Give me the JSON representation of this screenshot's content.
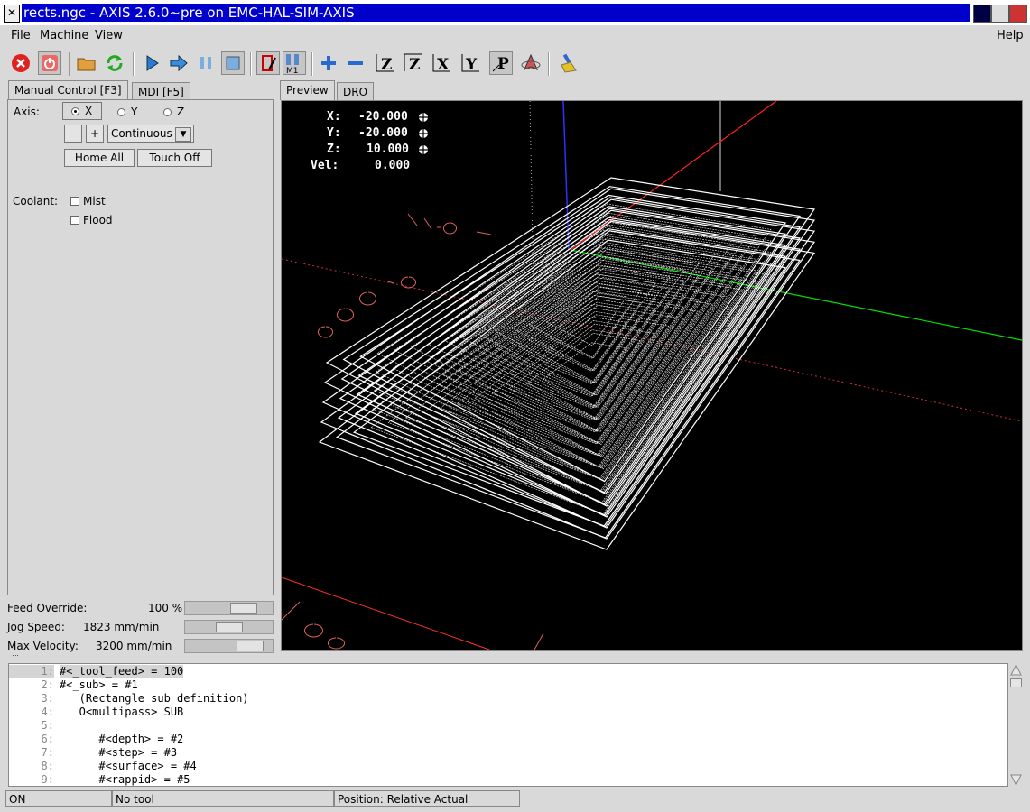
{
  "window": {
    "title": "rects.ngc - AXIS 2.6.0~pre on EMC-HAL-SIM-AXIS"
  },
  "menu": {
    "file": "File",
    "machine": "Machine",
    "view": "View",
    "help": "Help"
  },
  "toolbar": {
    "icons": [
      "estop-icon",
      "power-icon",
      "open-file-icon",
      "reload-icon",
      "run-icon",
      "step-icon",
      "pause-icon",
      "stop-icon",
      "block-delete-icon",
      "optional-stop-icon",
      "zoom-in-icon",
      "zoom-out-icon",
      "view-z-icon",
      "view-z2-icon",
      "view-x-icon",
      "view-y-icon",
      "view-p-icon",
      "rotate-view-icon",
      "clear-plot-icon"
    ],
    "labels": {
      "z": "Z",
      "z2": "Z",
      "x": "X",
      "y": "Y",
      "p": "P",
      "m1": "M1"
    }
  },
  "tabs": {
    "manual": "Manual Control [F3]",
    "mdi": "MDI [F5]",
    "preview": "Preview",
    "dro": "DRO"
  },
  "manual": {
    "axis_label": "Axis:",
    "axes": [
      "X",
      "Y",
      "Z"
    ],
    "selected_axis": "X",
    "minus": "-",
    "plus": "+",
    "jog_mode": "Continuous",
    "home_all": "Home All",
    "touch_off": "Touch Off",
    "coolant_label": "Coolant:",
    "mist": "Mist",
    "flood": "Flood"
  },
  "overrides": {
    "feed_label": "Feed Override:",
    "feed_value": "100 %",
    "feed_level": 0.75,
    "jog_label": "Jog Speed:",
    "jog_value": "1823 mm/min",
    "jog_level": 0.5,
    "maxvel_label": "Max Velocity:",
    "maxvel_value": "3200 mm/min",
    "maxvel_level": 0.85
  },
  "dro": {
    "x_label": "X:",
    "x_value": "-20.000",
    "y_label": "Y:",
    "y_value": "-20.000",
    "z_label": "Z:",
    "z_value": "10.000",
    "vel_label": "Vel:",
    "vel_value": "0.000"
  },
  "code": [
    {
      "n": "1:",
      "t": "#<_tool_feed> = 100"
    },
    {
      "n": "2:",
      "t": "#<_sub> = #1"
    },
    {
      "n": "3:",
      "t": "   (Rectangle sub definition)"
    },
    {
      "n": "4:",
      "t": "   O<multipass> SUB"
    },
    {
      "n": "5:",
      "t": ""
    },
    {
      "n": "6:",
      "t": "      #<depth> = #2"
    },
    {
      "n": "7:",
      "t": "      #<step> = #3"
    },
    {
      "n": "8:",
      "t": "      #<surface> = #4"
    },
    {
      "n": "9:",
      "t": "      #<rappid> = #5"
    }
  ],
  "status": {
    "state": "ON",
    "tool": "No tool",
    "position": "Position: Relative Actual"
  },
  "colors": {
    "titlebar": "#0000cc",
    "preview_bg": "#000000",
    "axis_x": "#ff2020",
    "axis_y": "#00ff00",
    "axis_z": "#3030ff"
  }
}
